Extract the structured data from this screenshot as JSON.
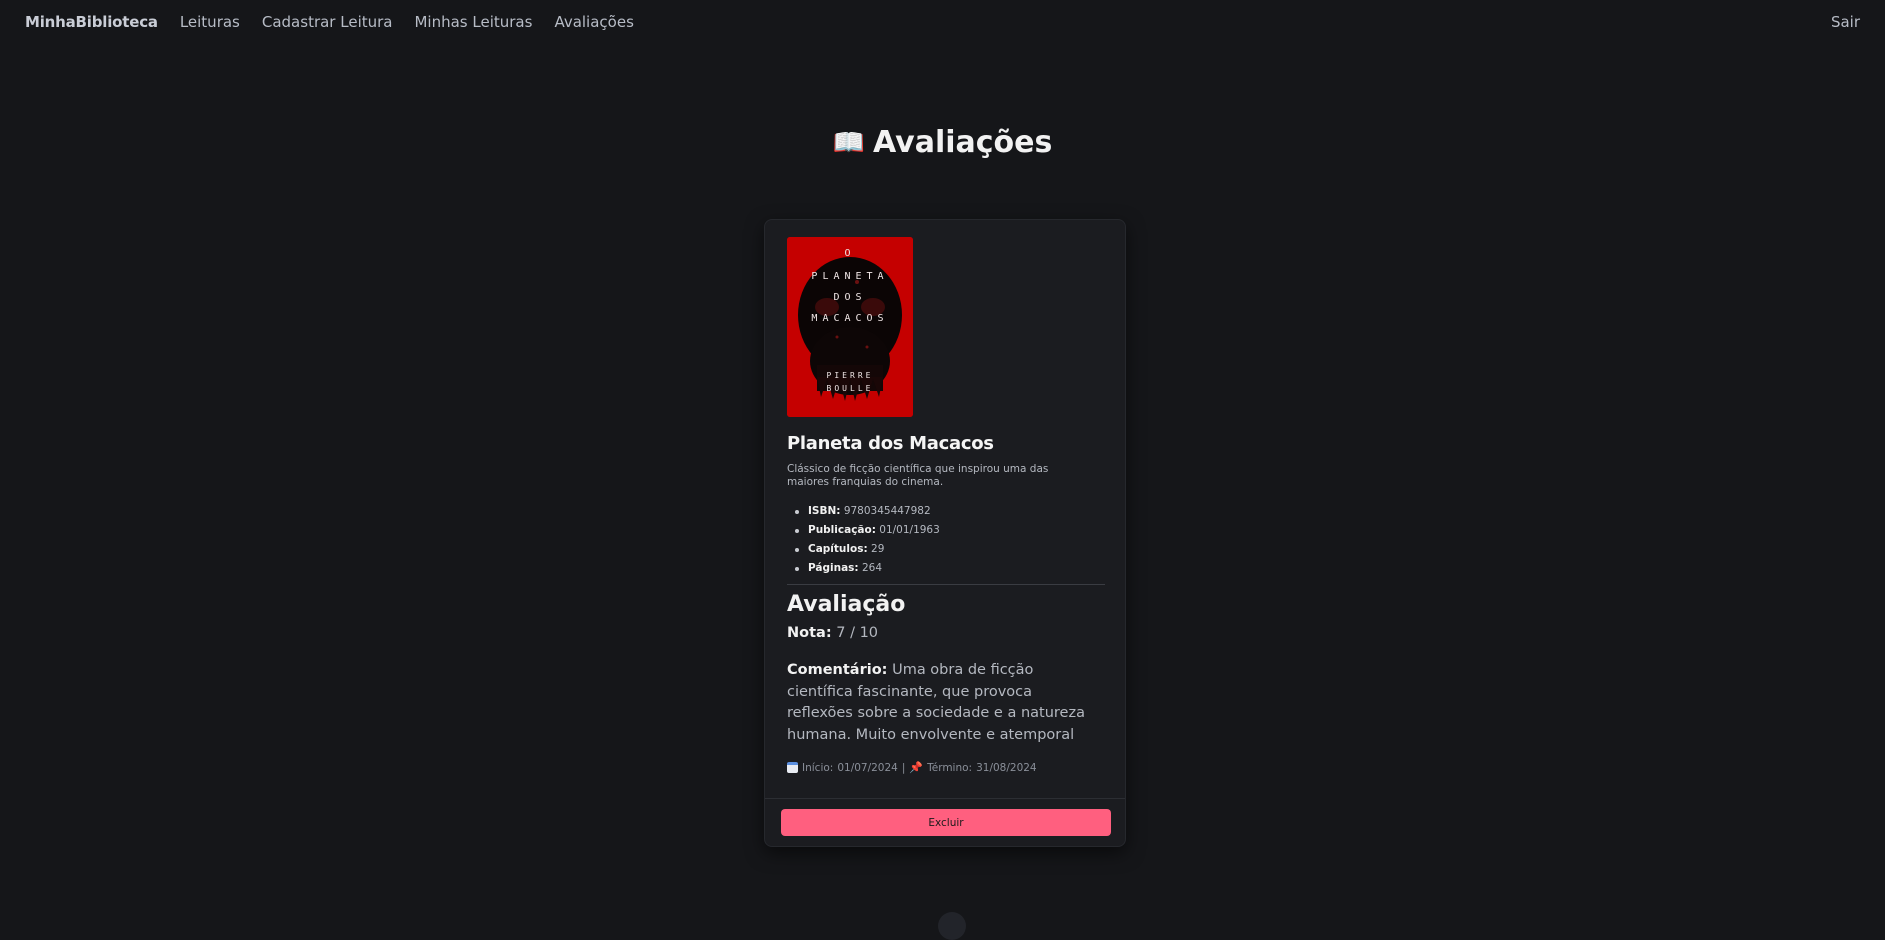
{
  "nav": {
    "brand": "MinhaBiblioteca",
    "links": [
      "Leituras",
      "Cadastrar Leitura",
      "Minhas Leituras",
      "Avaliações"
    ],
    "logout": "Sair"
  },
  "page": {
    "title": "Avaliações",
    "title_icon": "📖"
  },
  "book": {
    "cover_lines": [
      "O",
      "PLANETA",
      "DOS",
      "MACACOS",
      "PIERRE",
      "BOULLE"
    ],
    "cover_color": "#c50000",
    "title": "Planeta dos Macacos",
    "description": "Clássico de ficção científica que inspirou uma das maiores franquias do cinema.",
    "info": [
      {
        "label": "ISBN:",
        "value": "9780345447982"
      },
      {
        "label": "Publicação:",
        "value": "01/01/1963"
      },
      {
        "label": "Capítulos:",
        "value": "29"
      },
      {
        "label": "Páginas:",
        "value": "264"
      }
    ]
  },
  "review": {
    "heading": "Avaliação",
    "score_label": "Nota:",
    "score_value": "7 / 10",
    "comment_label": "Comentário:",
    "comment_text": "Uma obra de ficção científica fascinante, que provoca reflexões sobre a sociedade e a natureza humana. Muito envolvente e atemporal",
    "start_label": "Início:",
    "start_date": "01/07/2024",
    "separator": "|",
    "end_label": "Término:",
    "end_date": "31/08/2024"
  },
  "actions": {
    "delete_label": "Excluir",
    "delete_color": "#ff5f7f"
  }
}
